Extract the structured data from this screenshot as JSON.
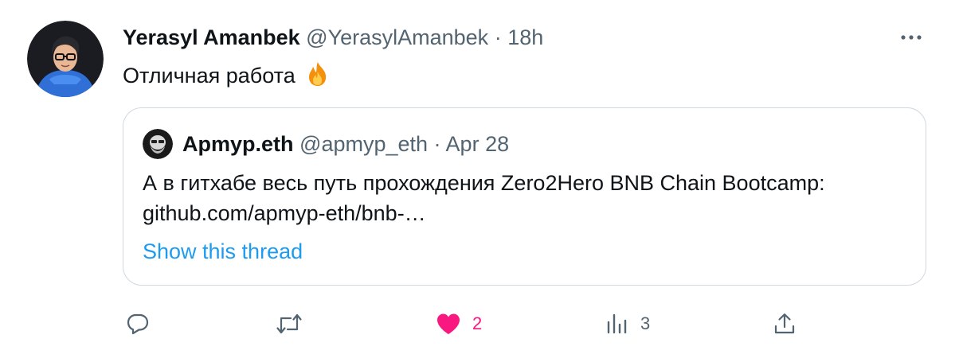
{
  "tweet": {
    "author_name": "Yerasyl Amanbek",
    "author_handle": "@YerasylAmanbek",
    "separator": " · ",
    "time": "18h",
    "text": "Отличная работа",
    "emoji": "fire-emoji"
  },
  "quote": {
    "author_name": "Apmyp.eth",
    "author_handle": "@apmyp_eth",
    "separator": " · ",
    "date": "Apr 28",
    "text": "А в гитхабе весь путь прохождения Zero2Hero BNB Chain Bootcamp: github.com/apmyp-eth/bnb-…",
    "show_thread": "Show this thread"
  },
  "actions": {
    "reply_icon": "reply-icon",
    "retweet_icon": "retweet-icon",
    "like_icon": "heart-filled-icon",
    "like_count": "2",
    "views_icon": "analytics-icon",
    "views_count": "3",
    "share_icon": "share-icon"
  },
  "colors": {
    "text_primary": "#0f1419",
    "text_secondary": "#536471",
    "link": "#1d9bf0",
    "like": "#f91880",
    "border": "#cfd9de"
  }
}
